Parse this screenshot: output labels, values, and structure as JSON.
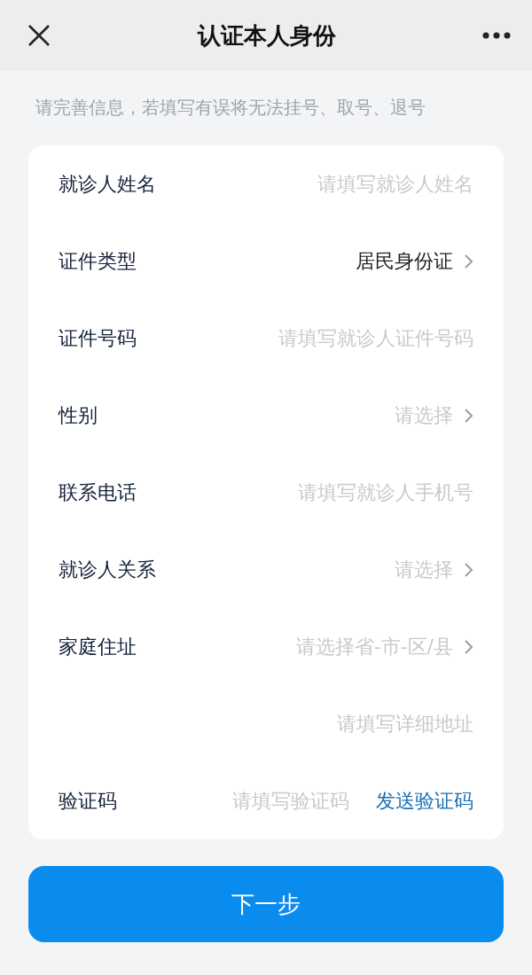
{
  "header": {
    "title": "认证本人身份"
  },
  "notice": "请完善信息，若填写有误将无法挂号、取号、退号",
  "form": {
    "rows": [
      {
        "kind": "input",
        "label": "就诊人姓名",
        "placeholder": "请填写就诊人姓名"
      },
      {
        "kind": "select",
        "label": "证件类型",
        "value": "居民身份证"
      },
      {
        "kind": "input",
        "label": "证件号码",
        "placeholder": "请填写就诊人证件号码"
      },
      {
        "kind": "select",
        "label": "性别",
        "placeholder": "请选择"
      },
      {
        "kind": "input",
        "label": "联系电话",
        "placeholder": "请填写就诊人手机号"
      },
      {
        "kind": "select",
        "label": "就诊人关系",
        "placeholder": "请选择"
      },
      {
        "kind": "select",
        "label": "家庭住址",
        "placeholder": "请选择省-市-区/县"
      },
      {
        "kind": "input",
        "placeholder": "请填写详细地址"
      },
      {
        "kind": "code",
        "label": "验证码",
        "placeholder": "请填写验证码",
        "action": "发送验证码"
      }
    ]
  },
  "submit": "下一步"
}
